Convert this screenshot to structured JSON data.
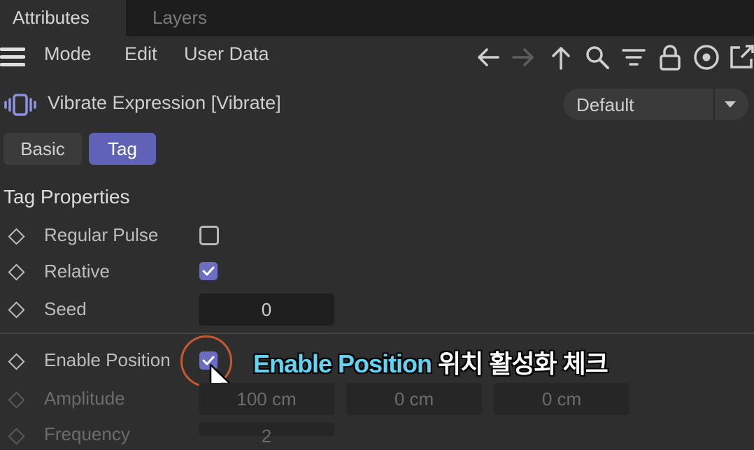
{
  "tabs": {
    "attributes": "Attributes",
    "layers": "Layers"
  },
  "menu": {
    "mode": "Mode",
    "edit": "Edit",
    "user_data": "User Data"
  },
  "toolbar_icons": [
    "back-arrow-icon",
    "forward-arrow-icon",
    "up-arrow-icon",
    "search-icon",
    "filter-icon",
    "lock-icon",
    "target-icon",
    "open-new-window-icon"
  ],
  "object": {
    "title": "Vibrate Expression [Vibrate]",
    "preset": "Default"
  },
  "mode_tabs": {
    "basic": "Basic",
    "tag": "Tag"
  },
  "section_title": "Tag Properties",
  "properties": {
    "regular_pulse": {
      "label": "Regular Pulse",
      "checked": false
    },
    "relative": {
      "label": "Relative",
      "checked": true
    },
    "seed": {
      "label": "Seed",
      "value": "0"
    },
    "enable_position": {
      "label": "Enable Position",
      "checked": true
    },
    "amplitude": {
      "label": "Amplitude",
      "x": "100 cm",
      "y": "0 cm",
      "z": "0 cm"
    },
    "frequency": {
      "label": "Frequency",
      "value": "2"
    }
  },
  "caption": {
    "en": "Enable Position",
    "ko": " 위치 활성화 체크"
  },
  "colors": {
    "accent": "#5f62b6",
    "caption_highlight": "#62d3f0",
    "ring": "#c45a2d"
  }
}
